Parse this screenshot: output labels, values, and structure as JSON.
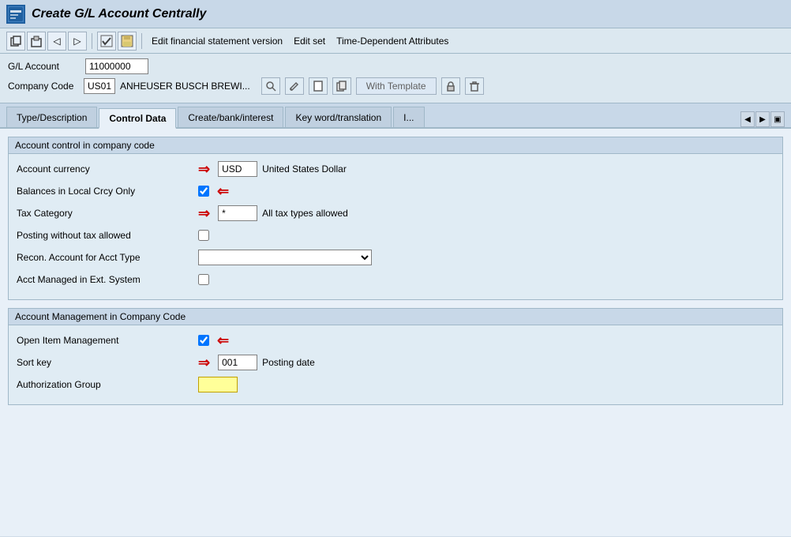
{
  "titleBar": {
    "title": "Create G/L Account Centrally",
    "appIconLabel": "SAP"
  },
  "toolbar": {
    "buttons": [
      "↩",
      "↻",
      "◁",
      "▷"
    ],
    "links": [
      {
        "label": "Edit financial statement version"
      },
      {
        "label": "Edit set"
      },
      {
        "label": "Time-Dependent Attributes"
      }
    ]
  },
  "formHeader": {
    "glAccountLabel": "G/L Account",
    "glAccountValue": "11000000",
    "companyCodeLabel": "Company Code",
    "companyCodeValue": "US01",
    "companyName": "ANHEUSER BUSCH BREWI...",
    "withTemplateLabel": "With Template"
  },
  "tabs": [
    {
      "label": "Type/Description",
      "active": false
    },
    {
      "label": "Control Data",
      "active": true
    },
    {
      "label": "Create/bank/interest",
      "active": false
    },
    {
      "label": "Key word/translation",
      "active": false
    },
    {
      "label": "I...",
      "active": false
    }
  ],
  "sections": {
    "accountControl": {
      "title": "Account control in company code",
      "fields": [
        {
          "label": "Account currency",
          "inputValue": "USD",
          "inputSize": "small",
          "description": "United States Dollar",
          "hasArrowRight": true,
          "hasCheckbox": false,
          "type": "input-text"
        },
        {
          "label": "Balances in Local Crcy Only",
          "hasCheckbox": true,
          "checked": true,
          "hasArrowLeft": true,
          "type": "checkbox"
        },
        {
          "label": "Tax Category",
          "inputValue": "*",
          "inputSize": "small",
          "description": "All tax types allowed",
          "hasArrowRight": true,
          "type": "input-text"
        },
        {
          "label": "Posting without tax allowed",
          "hasCheckbox": true,
          "checked": false,
          "type": "checkbox"
        },
        {
          "label": "Recon. Account for Acct Type",
          "hasSelect": true,
          "selectValue": "",
          "type": "select"
        },
        {
          "label": "Acct Managed in Ext. System",
          "hasCheckbox": true,
          "checked": false,
          "type": "checkbox"
        }
      ]
    },
    "accountManagement": {
      "title": "Account Management in Company Code",
      "fields": [
        {
          "label": "Open Item Management",
          "hasCheckbox": true,
          "checked": true,
          "hasArrowLeft": true,
          "type": "checkbox"
        },
        {
          "label": "Sort key",
          "inputValue": "001",
          "inputSize": "small",
          "description": "Posting date",
          "hasArrowRight": true,
          "type": "input-text"
        },
        {
          "label": "Authorization Group",
          "inputValue": "",
          "inputSize": "small",
          "isYellow": true,
          "type": "input-yellow"
        }
      ]
    }
  }
}
